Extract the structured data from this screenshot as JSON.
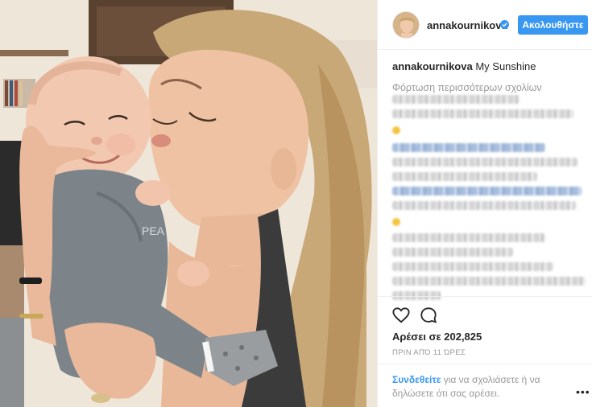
{
  "post": {
    "username": "annakournikova",
    "follow_label": "Ακολουθήστε",
    "caption_user": "annakournikova",
    "caption_text": "My Sunshine",
    "load_more": "Φόρτωση περισσότερων σχολίων",
    "likes": "Αρέσει σε 202,825",
    "time_ago": "ΠΡΙΝ ΑΠΌ 11 ΏΡΕΣ",
    "login_link": "Συνδεθείτε",
    "login_rest": " για να σχολιάσετε ή να δηλώσετε ότι σας αρέσει.",
    "more_options": "•••"
  },
  "icons": {
    "verified": "verified-badge-icon",
    "heart": "heart-icon",
    "comment": "comment-icon"
  },
  "colors": {
    "accent": "#3897f0",
    "muted": "#999999",
    "text": "#262626"
  }
}
